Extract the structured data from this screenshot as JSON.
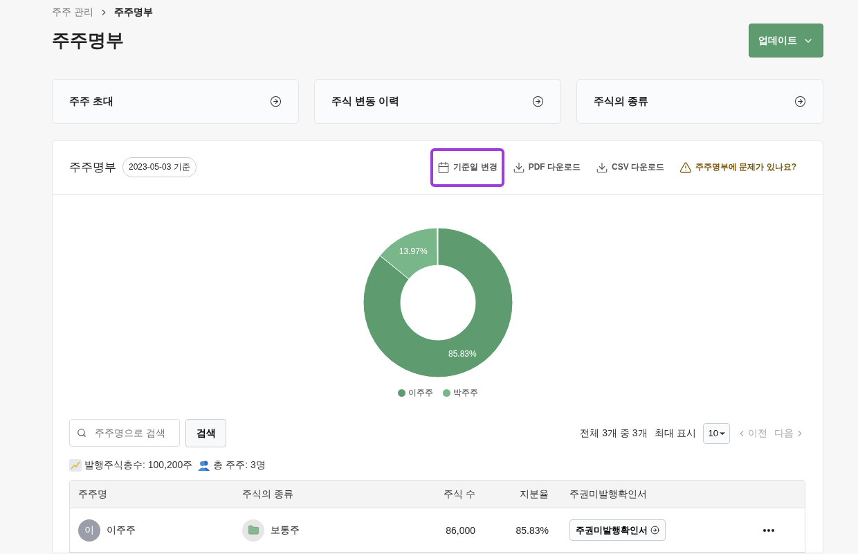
{
  "breadcrumb": [
    {
      "label": "주주 관리",
      "current": false
    },
    {
      "label": "주주명부",
      "current": true
    }
  ],
  "page_title": "주주명부",
  "update_button": {
    "label": "업데이트"
  },
  "nav_cards": [
    {
      "label": "주주 초대"
    },
    {
      "label": "주식 변동 이력"
    },
    {
      "label": "주식의 종류"
    }
  ],
  "register": {
    "title": "주주명부",
    "date_badge": "2023-05-03 기준",
    "actions": [
      {
        "kind": "calendar",
        "label": "기준일 변경",
        "highlighted": true
      },
      {
        "kind": "download",
        "label": "PDF 다운로드",
        "highlighted": false
      },
      {
        "kind": "download",
        "label": "CSV 다운로드",
        "highlighted": false
      },
      {
        "kind": "warning",
        "label": "주주명부에 문제가 있나요?",
        "highlighted": false
      }
    ],
    "chart_data": {
      "type": "donut",
      "categories": [
        "이주주",
        "박주주"
      ],
      "values": [
        85.83,
        13.97
      ],
      "colors": [
        "#5e9c6f",
        "#79b78b"
      ],
      "value_labels": [
        "85.83%",
        "13.97%"
      ]
    },
    "search": {
      "placeholder": "주주명으로 검색",
      "button": "검색"
    },
    "pagination": {
      "summary": "전체 3개 중 3개",
      "page_size_label": "최대 표시",
      "page_size": "10",
      "prev": {
        "label": "이전",
        "disabled": true
      },
      "next": {
        "label": "다음",
        "disabled": true
      }
    },
    "stats": [
      {
        "kind": "chart",
        "text": "발행주식총수: 100,200주"
      },
      {
        "kind": "people",
        "text": "총 주주: 3명"
      }
    ],
    "table": {
      "columns": [
        "주주명",
        "주식의 종류",
        "주식 수",
        "지분율",
        "주권미발행확인서"
      ],
      "rows": [
        {
          "avatar": "이",
          "name": "이주주",
          "share_type": "보통주",
          "shares": "86,000",
          "ratio": "85.83%",
          "certificate_button": "주권미발행확인서"
        }
      ]
    }
  }
}
